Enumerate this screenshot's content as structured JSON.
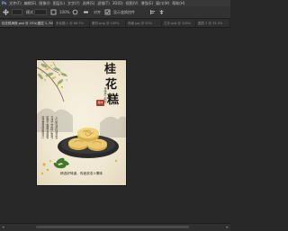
{
  "app": {
    "logo": "Ps"
  },
  "menu": [
    "文件(F)",
    "编辑(E)",
    "图像(I)",
    "图层(L)",
    "文字(Y)",
    "选择(S)",
    "滤镜(T)",
    "3D(D)",
    "视图(V)",
    "增强(E)",
    "窗口(W)",
    "帮助(H)"
  ],
  "options": {
    "mode_label": "模式",
    "zoom_label": "100%",
    "align_label": "对齐",
    "extra_label": "显示变换控件"
  },
  "tabs": [
    {
      "label": "桂花糕海报.psd @ 25%(图层 1, RGB/8)"
    },
    {
      "label": "未标题-1 @ 66.7%"
    },
    {
      "label": "素材.png @ 100%"
    },
    {
      "label": "背景.jpg @ 50%"
    },
    {
      "label": "文字.psd @ 100%"
    },
    {
      "label": "图层 2 @ 33.3%"
    }
  ],
  "poster": {
    "title_chars": [
      "桂",
      "花",
      "糕"
    ],
    "seal": "美味",
    "subtitle": "传统手工制作",
    "columns": [
      "桂花香甜软糯可口",
      "精选上等糯米原料",
      "古法工艺匠心制作",
      "入口即化回味无穷"
    ],
    "slogan": "精选好味道，传递浓浓人情味"
  },
  "colors": {
    "poster_bg": "#efe7d1",
    "title": "#1d1a15",
    "seal": "#b8312a",
    "cake": "#e8c46a",
    "plate": "#2a2a2a",
    "leaf": "#3f7a2a",
    "flower": "#e0b23a"
  }
}
